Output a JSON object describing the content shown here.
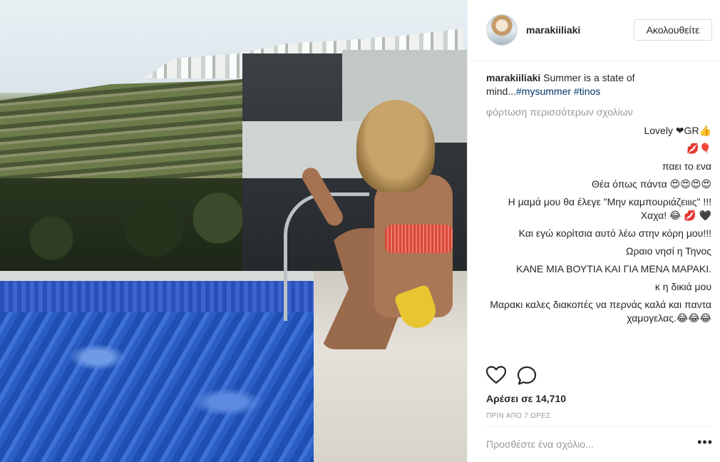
{
  "post": {
    "username": "marakiiliaki",
    "follow_label": "Ακολουθείτε",
    "caption": {
      "username": "marakiiliaki",
      "text": "Summer is a state of mind...",
      "tags": [
        "#mysummer",
        "#tinos"
      ]
    },
    "load_more": "φόρτωση περισσότερων σχολίων",
    "comments": [
      {
        "text": "Lovely ❤GR👍"
      },
      {
        "text": "💋🎈"
      },
      {
        "text": "παει το ενα"
      },
      {
        "text": "Θέα όπως πάντα 😍😍😍😍"
      },
      {
        "text": "Η μαμά μου θα έλεγε \"Μην καμπουριάζειιις\" !!! Χαχα! 😂 💋 🖤"
      },
      {
        "text": "Και εγώ κορίτσια αυτό λέω στην κόρη μου!!!"
      },
      {
        "text": "Ωραιο νησί η Τηνος"
      },
      {
        "text": "ΚΑΝΕ ΜΙΑ ΒΟΥΤΙΑ ΚΑΙ ΓΙΑ ΜΕΝΑ ΜΑΡΑΚΙ."
      },
      {
        "text": "κ η δικιά μου"
      },
      {
        "text": "Μαρακι καλες διακοπές να περνάς καλά και παντα χαμογελας.😂😂😂"
      }
    ],
    "likes": "Αρέσει σε 14,710",
    "time": "ΠΡΙΝ ΑΠΟ 7 ΩΡΕΣ",
    "add_comment_placeholder": "Προσθέστε ένα σχόλιο...",
    "more_options": "•••"
  },
  "icons": {
    "like": "heart-icon",
    "comment": "comment-bubble-icon",
    "more": "more-dots-icon"
  }
}
